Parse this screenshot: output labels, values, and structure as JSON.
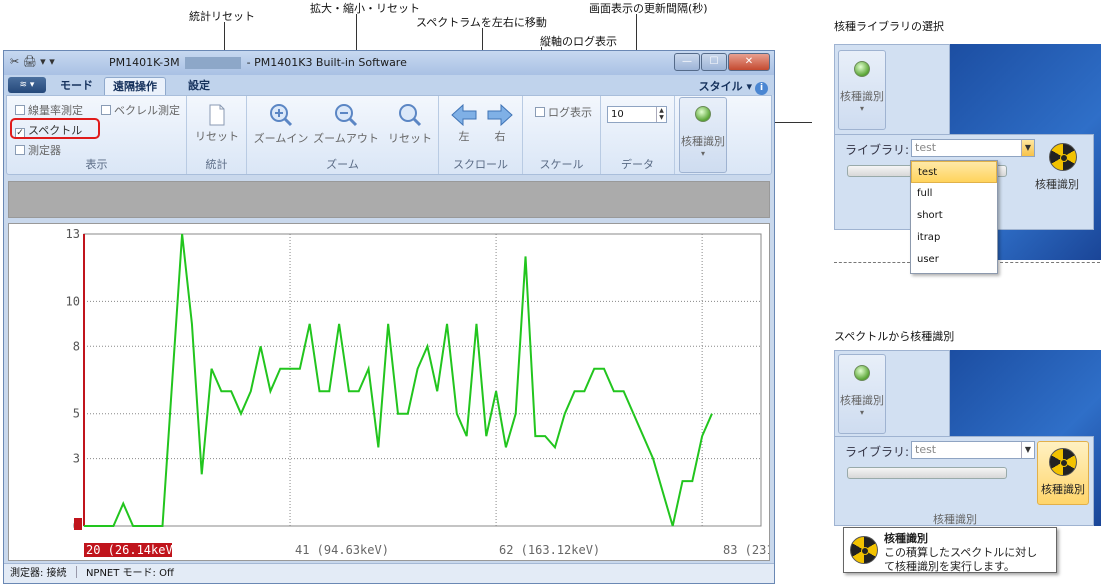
{
  "callouts": {
    "stats_reset": "統計リセット",
    "zoom": "拡大・縮小・リセット",
    "scroll": "スペクトラムを左右に移動",
    "log_axis": "縦軸のログ表示",
    "refresh_interval": "画面表示の更新間隔(秒)",
    "library_select": "核種ライブラリの選択",
    "identify_from_spectrum": "スペクトルから核種識別"
  },
  "window": {
    "title_device": "PM1401K-3M",
    "title_app": " - PM1401K3 Built-in Software",
    "quick_access": "✂ 🖨 ▾ ▾"
  },
  "tabs": [
    {
      "label": "モード"
    },
    {
      "label": "遠隔操作"
    },
    {
      "label": "設定"
    }
  ],
  "style_menu": "スタイル",
  "ribbon": {
    "display": {
      "label": "表示",
      "items": [
        "線量率測定",
        "スペクトル",
        "測定器",
        "ベクレル測定"
      ]
    },
    "stats": {
      "label": "統計",
      "reset": "リセット"
    },
    "zoom": {
      "label": "ズーム",
      "zoom_in": "ズームイン",
      "zoom_out": "ズームアウト",
      "reset": "リセット"
    },
    "scroll": {
      "label": "スクロール",
      "left": "左",
      "right": "右"
    },
    "scale": {
      "label": "スケール",
      "log": "ログ表示"
    },
    "data": {
      "label": "データ",
      "interval": "10"
    },
    "identify": {
      "label": "核種識別"
    }
  },
  "status_bar": {
    "device": "測定器: 接続",
    "npnet": "NPNET モード: Off"
  },
  "colors": {
    "line": "#22c51e",
    "axis_marker": "#c0141c",
    "highlight": "#e01b1b"
  },
  "chart_data": {
    "type": "line",
    "y_ticks": [
      "0",
      "3",
      "5",
      "8",
      "10",
      "13"
    ],
    "ylim": [
      0,
      13
    ],
    "x_labels": [
      "20 (26.14keV)",
      "41 (94.63keV)",
      "62 (163.12keV)",
      "83 (231.62keV)"
    ],
    "xlim": [
      20,
      89
    ],
    "grid": true,
    "series": [
      {
        "values": [
          [
            20,
            0
          ],
          [
            23,
            0
          ],
          [
            24,
            1
          ],
          [
            25,
            0
          ],
          [
            28,
            0
          ],
          [
            30,
            13
          ],
          [
            31,
            9
          ],
          [
            32,
            2.3
          ],
          [
            33,
            7
          ],
          [
            34,
            6
          ],
          [
            35,
            6
          ],
          [
            36,
            5
          ],
          [
            37,
            6
          ],
          [
            38,
            8
          ],
          [
            39,
            6
          ],
          [
            40,
            7
          ],
          [
            41,
            7
          ],
          [
            42,
            7
          ],
          [
            43,
            9
          ],
          [
            44,
            6
          ],
          [
            45,
            6
          ],
          [
            46,
            9
          ],
          [
            47,
            6
          ],
          [
            48,
            6
          ],
          [
            49,
            7
          ],
          [
            50,
            3.5
          ],
          [
            51,
            9
          ],
          [
            52,
            5
          ],
          [
            53,
            5
          ],
          [
            54,
            7
          ],
          [
            55,
            8
          ],
          [
            56,
            6
          ],
          [
            57,
            9
          ],
          [
            58,
            5
          ],
          [
            59,
            4
          ],
          [
            60,
            9
          ],
          [
            61,
            4
          ],
          [
            62,
            6
          ],
          [
            63,
            3.5
          ],
          [
            64,
            5
          ],
          [
            65,
            12
          ],
          [
            66,
            4
          ],
          [
            67,
            4
          ],
          [
            68,
            3.5
          ],
          [
            69,
            5
          ],
          [
            70,
            6
          ],
          [
            71,
            6
          ],
          [
            72,
            7
          ],
          [
            73,
            7
          ],
          [
            74,
            6
          ],
          [
            75,
            6
          ],
          [
            78,
            3
          ],
          [
            80,
            0
          ],
          [
            81,
            2
          ],
          [
            82,
            2
          ],
          [
            83,
            4
          ],
          [
            84,
            5
          ]
        ]
      }
    ]
  },
  "library_panel": {
    "button_label": "核種識別",
    "library_label": "ライブラリ:",
    "library_value": "test",
    "identify_label": "核種識別",
    "options": [
      "test",
      "full",
      "short",
      "itrap",
      "user"
    ]
  },
  "identify_panel": {
    "button_label": "核種識別",
    "library_label": "ライブラリ:",
    "library_value": "test",
    "identify_label": "核種識別",
    "group_label": "核種識別",
    "tooltip_title": "核種識別",
    "tooltip_line1": "この積算したスペクトルに対し",
    "tooltip_line2": "て核種識別を実行します。"
  }
}
